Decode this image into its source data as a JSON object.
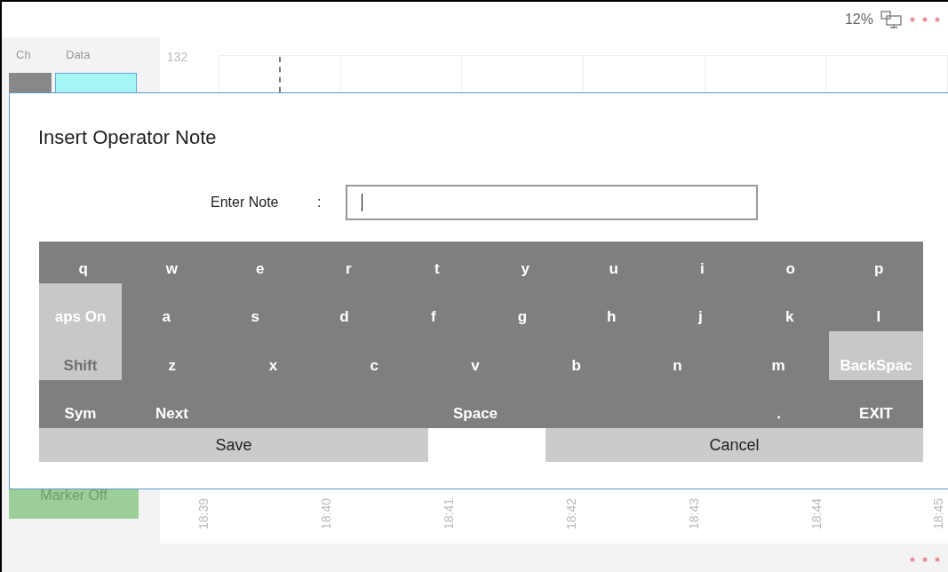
{
  "status_bar": {
    "percent": "12%"
  },
  "table": {
    "columns": [
      "Ch",
      "Data"
    ]
  },
  "chart": {
    "y_label": "132",
    "x_labels": [
      "18:39",
      "18:40",
      "18:41",
      "18:42",
      "18:43",
      "18:44",
      "18:45"
    ]
  },
  "marker_button": {
    "label": "Marker Off",
    "disabled": true
  },
  "dialog": {
    "title": "Insert Operator Note",
    "field": {
      "label": "Enter Note",
      "separator": ":"
    },
    "keyboard": [
      [
        {
          "label": "q",
          "highlighted": false
        },
        {
          "label": "w",
          "highlighted": false
        },
        {
          "label": "e",
          "highlighted": false
        },
        {
          "label": "r",
          "highlighted": false
        },
        {
          "label": "t",
          "highlighted": false
        },
        {
          "label": "y",
          "highlighted": false
        },
        {
          "label": "u",
          "highlighted": false
        },
        {
          "label": "i",
          "highlighted": false
        },
        {
          "label": "o",
          "highlighted": false
        },
        {
          "label": "p",
          "highlighted": false
        }
      ],
      [
        {
          "label": "aps On",
          "highlighted": true,
          "kind": "side"
        },
        {
          "label": "a",
          "highlighted": false
        },
        {
          "label": "s",
          "highlighted": false
        },
        {
          "label": "d",
          "highlighted": false
        },
        {
          "label": "f",
          "highlighted": false
        },
        {
          "label": "g",
          "highlighted": false
        },
        {
          "label": "h",
          "highlighted": false
        },
        {
          "label": "j",
          "highlighted": false
        },
        {
          "label": "k",
          "highlighted": false
        },
        {
          "label": "l",
          "highlighted": false
        }
      ],
      [
        {
          "label": "Shift",
          "highlighted": true,
          "kind": "side",
          "dim_text": true
        },
        {
          "label": "z",
          "highlighted": false
        },
        {
          "label": "x",
          "highlighted": false
        },
        {
          "label": "c",
          "highlighted": false
        },
        {
          "label": "v",
          "highlighted": false
        },
        {
          "label": "b",
          "highlighted": false
        },
        {
          "label": "n",
          "highlighted": false
        },
        {
          "label": "m",
          "highlighted": false
        },
        {
          "label": "BackSpac",
          "highlighted": true,
          "kind": "side_right"
        }
      ],
      [
        {
          "label": "Sym",
          "highlighted": false,
          "kind": "side"
        },
        {
          "label": "Next",
          "highlighted": false
        },
        {
          "label": "Space",
          "highlighted": false,
          "kind": "wide"
        },
        {
          "label": ".",
          "highlighted": false
        },
        {
          "label": "EXIT",
          "highlighted": false,
          "kind": "side_right"
        }
      ]
    ],
    "buttons": [
      "Save",
      "Cancel"
    ]
  }
}
